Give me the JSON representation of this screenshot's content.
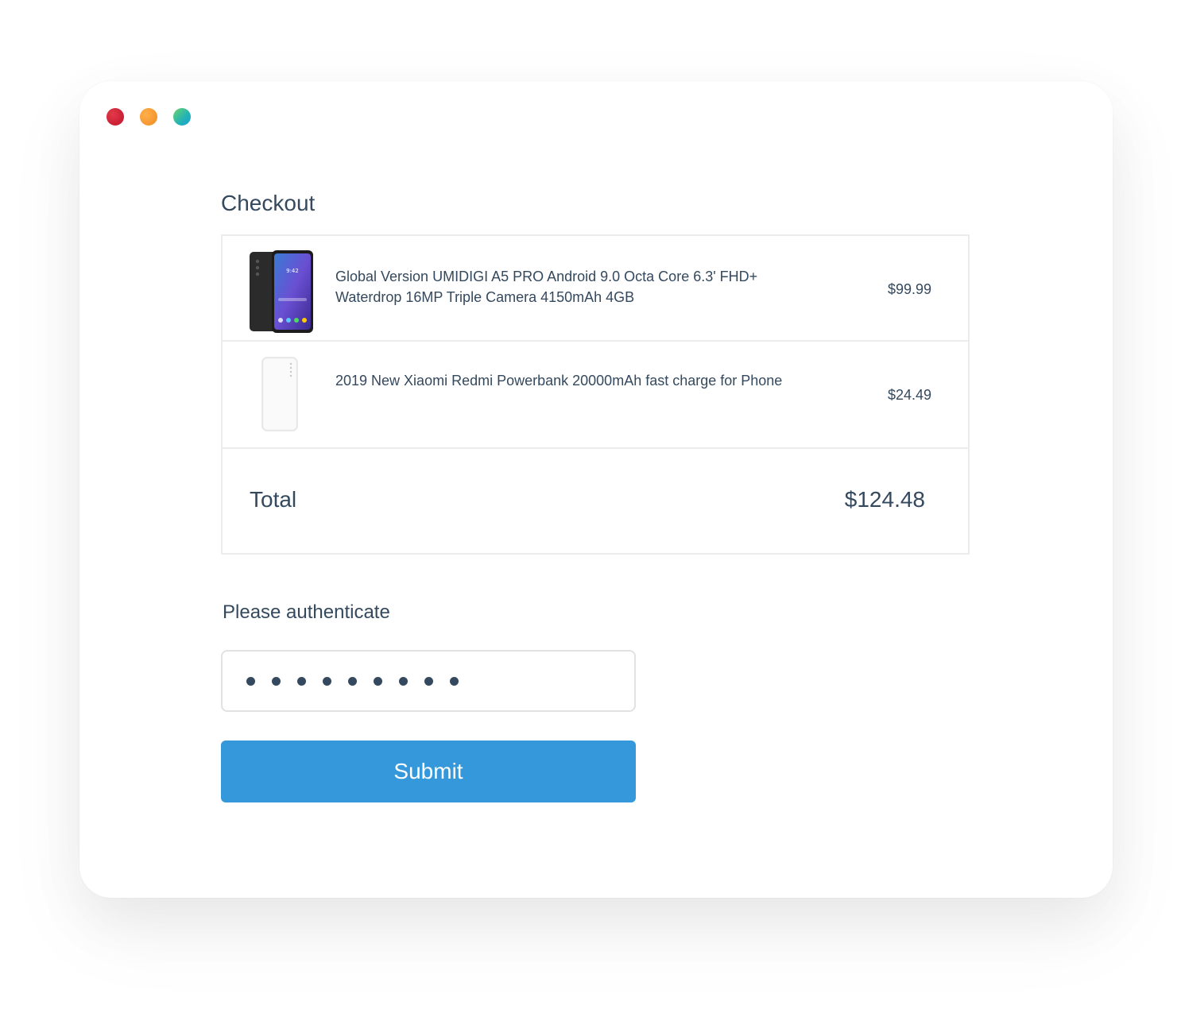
{
  "window": {
    "controls": [
      "close",
      "minimize",
      "zoom"
    ]
  },
  "checkout": {
    "title": "Checkout",
    "items": [
      {
        "name": "Global Version UMIDIGI A5 PRO Android 9.0 Octa Core 6.3' FHD+ Waterdrop 16MP Triple Camera 4150mAh 4GB",
        "price": "$99.99",
        "image_icon": "smartphone-icon",
        "phone_time": "9:42"
      },
      {
        "name": "2019 New Xiaomi Redmi Powerbank 20000mAh fast charge for Phone",
        "price": "$24.49",
        "image_icon": "powerbank-icon"
      }
    ],
    "total_label": "Total",
    "total_value": "$124.48"
  },
  "auth": {
    "label": "Please authenticate",
    "password_mask_count": 9
  },
  "submit": {
    "label": "Submit"
  },
  "colors": {
    "accent": "#3498db",
    "text": "#34495e",
    "border": "#ececec"
  }
}
